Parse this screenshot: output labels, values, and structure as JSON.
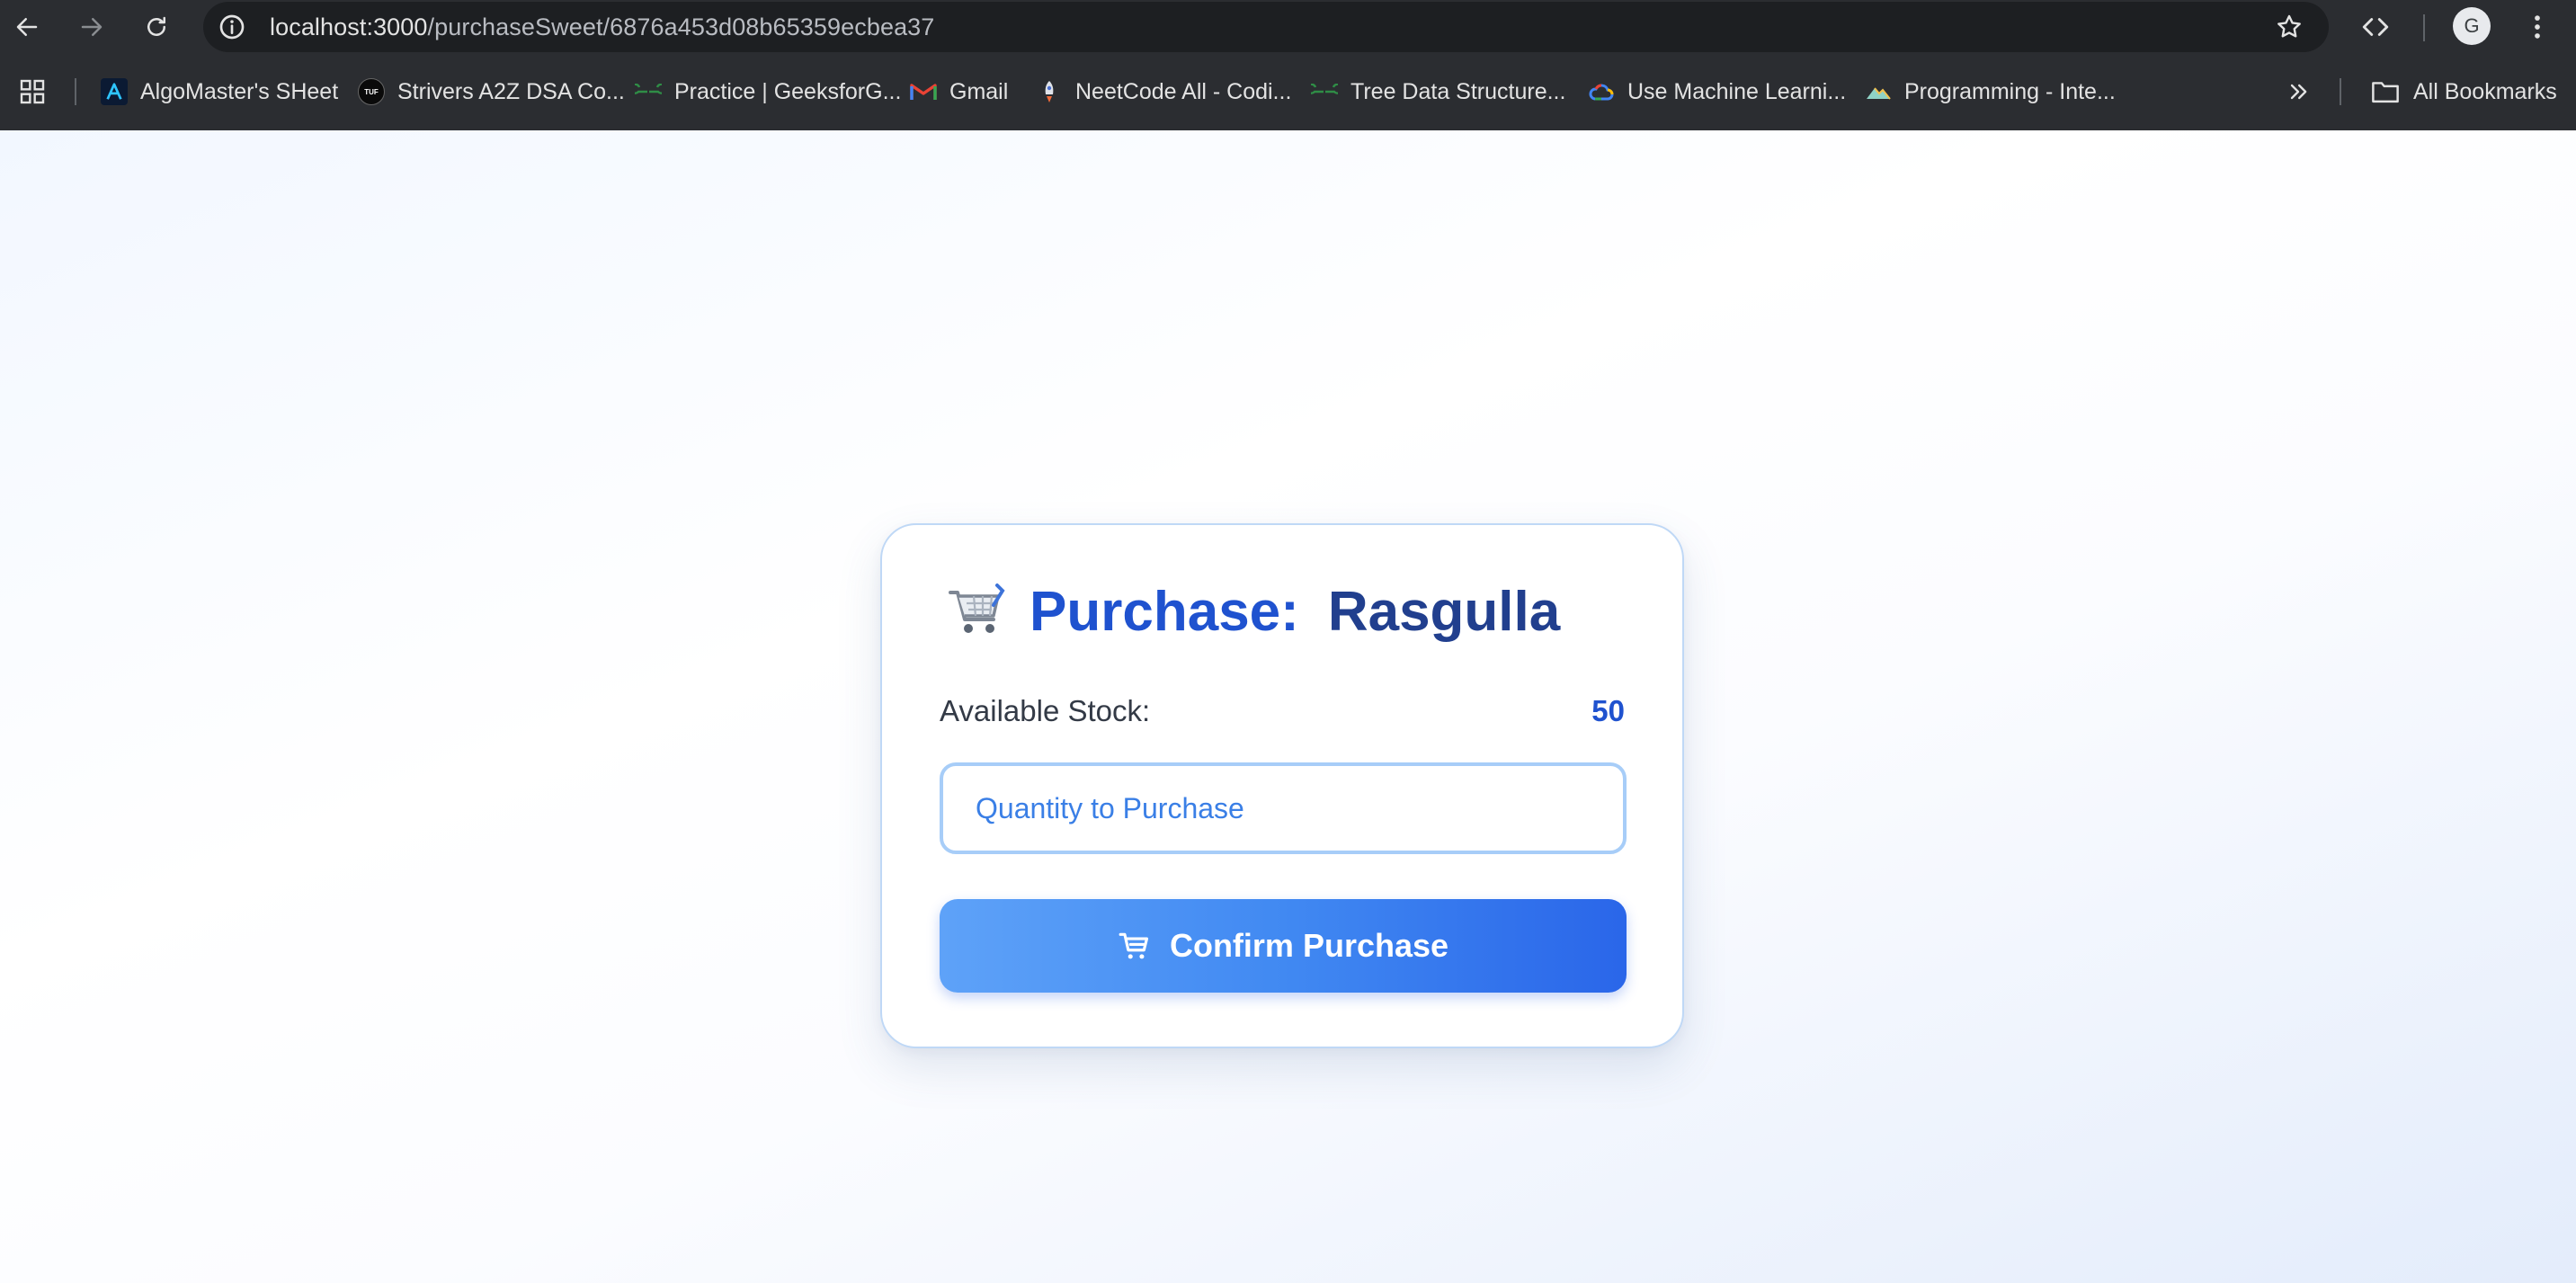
{
  "browser": {
    "url_host": "localhost:3000",
    "url_path": "/purchaseSweet/6876a453d08b65359ecbea37",
    "profile_initial": "G",
    "bookmarks": [
      {
        "label": "AlgoMaster's SHeet",
        "icon": "algomaster-icon"
      },
      {
        "label": "Strivers A2Z DSA Co...",
        "icon": "tuf-icon"
      },
      {
        "label": "Practice | GeeksforG...",
        "icon": "geeksforgeeks-icon"
      },
      {
        "label": "Gmail",
        "icon": "gmail-icon"
      },
      {
        "label": "NeetCode All - Codi...",
        "icon": "rocket-icon"
      },
      {
        "label": "Tree Data Structure...",
        "icon": "geeksforgeeks-icon"
      },
      {
        "label": "Use Machine Learni...",
        "icon": "google-cloud-icon"
      },
      {
        "label": "Programming - Inte...",
        "icon": "mountain-icon"
      }
    ],
    "all_bookmarks_label": "All Bookmarks"
  },
  "purchase": {
    "title_prefix": "Purchase:",
    "sweet_name": "Rasgulla",
    "stock_label": "Available Stock:",
    "stock_value": "50",
    "quantity_placeholder": "Quantity to Purchase",
    "quantity_value": "",
    "confirm_label": "Confirm Purchase",
    "title_icon": "shopping-cart-icon",
    "button_icon": "cart-icon"
  },
  "colors": {
    "accent": "#1f52cf",
    "button_start": "#5ea2f8",
    "button_end": "#2a66e9",
    "card_border": "#bfd8f6"
  }
}
